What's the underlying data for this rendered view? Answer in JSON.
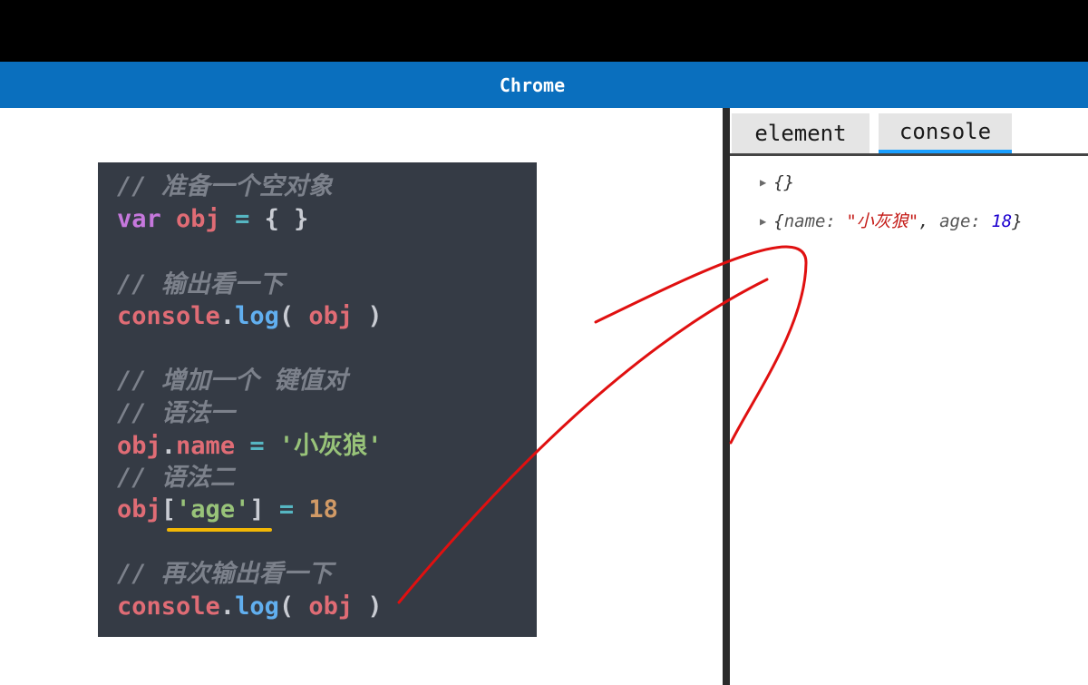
{
  "window": {
    "title": "Chrome"
  },
  "code": {
    "comment1": "// 准备一个空对象",
    "l2_kw": "var",
    "l2_id": "obj",
    "l2_op": "=",
    "l2_rest": "{ }",
    "comment2": "// 输出看一下",
    "console_word": "console",
    "dot": ".",
    "log_word": "log",
    "paren_open": "( ",
    "obj_word": "obj",
    "paren_close": " )",
    "comment3": "// 增加一个 键值对",
    "comment4": "// 语法一",
    "l8_prop": "name",
    "l8_value": "'小灰狼'",
    "comment5": "// 语法二",
    "l10_bracket_open": "[",
    "l10_key": "'age'",
    "l10_bracket_close": "]",
    "l10_value": "18",
    "comment6": "// 再次输出看一下"
  },
  "devtools": {
    "tabs": [
      {
        "label": "element",
        "active": false
      },
      {
        "label": "console",
        "active": true
      }
    ],
    "output": {
      "line1": "{}",
      "line2": {
        "open": "{",
        "name_key": "name: ",
        "name_value": "\"小灰狼\"",
        "sep": ", ",
        "age_key": "age: ",
        "age_value": "18",
        "close": "}"
      },
      "expand_icon": "triangle-right-icon"
    }
  },
  "colors": {
    "title_bar": "#0a6fbe",
    "code_bg": "#353b45",
    "active_tab_underline": "#1a9fff",
    "annotation": "#e01010",
    "highlight_underline": "#f2b705"
  }
}
